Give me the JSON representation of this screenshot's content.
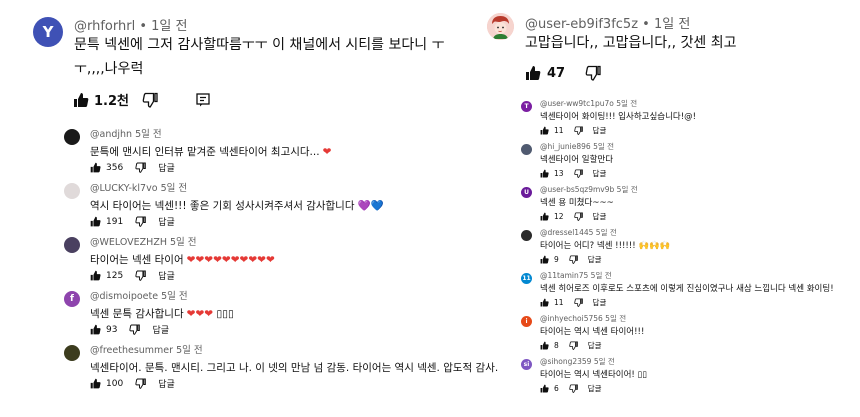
{
  "left": {
    "main": {
      "avatar_letter": "Y",
      "avatar_color": "#3f51b5",
      "handle": "@rhforhrl",
      "time": "1일 전",
      "text_line1": "문특 넥센에 그저 감사할따름ㅜㅜ 이 채널에서 시티를 보다니 ㅜ",
      "text_line2": "ㅜ,,,,나우럭",
      "likes": "1.2천",
      "icons": {
        "like": "thumb-up-icon",
        "dislike": "thumb-down-icon",
        "reply": "reply-icon"
      }
    },
    "replies": [
      {
        "handle": "@andjhn",
        "time": "5일 전",
        "text": "문특에 맨시티 인터뷰 맡겨준 넥센타이어 최고시다...",
        "suffix": "❤",
        "likes": "356",
        "reply_label": "답글",
        "avatar_color": "#1a1a1a"
      },
      {
        "handle": "@LUCKY-kl7vo",
        "time": "5일 전",
        "text": "역시 타이어는 넥센!!! 좋은 기회 성사시켜주셔서 감사합니다",
        "suffix": "💜💙",
        "likes": "191",
        "reply_label": "답글",
        "avatar_color": "#e0dada"
      },
      {
        "handle": "@WELOVEZHZH",
        "time": "5일 전",
        "text": "타이어는 넥센 타이어",
        "suffix": "❤❤❤❤❤❤❤❤❤❤",
        "likes": "125",
        "reply_label": "답글",
        "avatar_color": "#4a4060"
      },
      {
        "handle": "@dismoipoete",
        "time": "5일 전",
        "text": "넥센 문특 감사합니다",
        "suffix": "❤❤❤ ▯▯▯",
        "likes": "93",
        "reply_label": "답글",
        "avatar_letter": "f",
        "avatar_color": "#8e44ad"
      },
      {
        "handle": "@freethesummer",
        "time": "5일 전",
        "text": "넥센타이어. 문특. 맨시티. 그리고 나. 이 넷의 만남 넘 감동. 타이어는 역시 넥센. 압도적 감사.",
        "suffix": "",
        "likes": "100",
        "reply_label": "답글",
        "avatar_color": "#3c3c1e"
      }
    ]
  },
  "right": {
    "main": {
      "handle": "@user-eb9if3fc5z",
      "time": "1일 전",
      "text": "고맙읍니다,, 고맙읍니다,, 갓센 최고",
      "likes": "47",
      "avatar_color": "#f2c6c0"
    },
    "replies": [
      {
        "handle": "@user-ww9tc1pu7o",
        "time": "5일 전",
        "text": "넥센타이어 화이팅!!! 입사하고싶습니다!@!",
        "likes": "11",
        "reply_label": "답글",
        "avatar_letter": "T",
        "avatar_color": "#7b1fa2"
      },
      {
        "handle": "@hi_junie896",
        "time": "5일 전",
        "text": "넥센타이어 일할만다",
        "likes": "13",
        "reply_label": "답글",
        "avatar_color": "#505a70"
      },
      {
        "handle": "@user-bs5qz9mv9b",
        "time": "5일 전",
        "text": "넥센 용 미쳤다~~~",
        "likes": "12",
        "reply_label": "답글",
        "avatar_letter": "U",
        "avatar_color": "#6a1b9a"
      },
      {
        "handle": "@dressel1445",
        "time": "5일 전",
        "text": "타이어는 어디? 넥센 !!!!!!",
        "suffix": "🙌🙌🙌",
        "likes": "9",
        "reply_label": "답글",
        "avatar_color": "#2a2a2a"
      },
      {
        "handle": "@11tamin75",
        "time": "5일 전",
        "text": "넥센 히어로즈 이후로도 스포츠에 이렇게 진심이였구나 새삼 느낍니다 넥센 화이팅!",
        "likes": "11",
        "reply_label": "답글",
        "avatar_letter": "11",
        "avatar_color": "#0288d1"
      },
      {
        "handle": "@inhyechoi5756",
        "time": "5일 전",
        "text": "타이어는 역시 넥센 타이어!!!",
        "likes": "8",
        "reply_label": "답글",
        "avatar_letter": "i",
        "avatar_color": "#e64a19"
      },
      {
        "handle": "@sihong2359",
        "time": "5일 전",
        "text": "타이어는 역시 넥센타이어! ▯▯",
        "likes": "6",
        "reply_label": "답글",
        "avatar_letter": "si",
        "avatar_color": "#7e57c2"
      }
    ]
  }
}
